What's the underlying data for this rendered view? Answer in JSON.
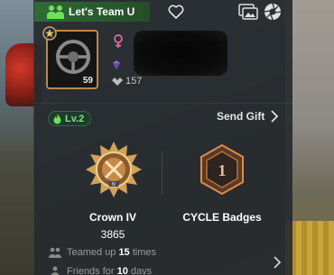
{
  "header": {
    "team_label": "Let's Team U",
    "heart_icon": "heart-outline-icon",
    "photo_icon": "photo-frame-icon",
    "aperture_icon": "aperture-icon"
  },
  "profile": {
    "avatar_level": "59",
    "gender_icon": "female-symbol-icon",
    "likes_count": "157",
    "level_badge": "Lv.2"
  },
  "actions": {
    "send_gift_label": "Send Gift"
  },
  "rank": {
    "name": "Crown IV",
    "points": "3865",
    "emblem_tier_label": "IV"
  },
  "cycle": {
    "label": "CYCLE Badges",
    "emblem_numeral": "1"
  },
  "stats": {
    "teamed_prefix": "Teamed up",
    "teamed_count": "15",
    "teamed_suffix": "times",
    "friends_prefix": "Friends for",
    "friends_count": "10",
    "friends_suffix": "days"
  },
  "colors": {
    "accent_green": "#6fe05a",
    "gold": "#d2a25a",
    "panel": "#262a2e"
  }
}
